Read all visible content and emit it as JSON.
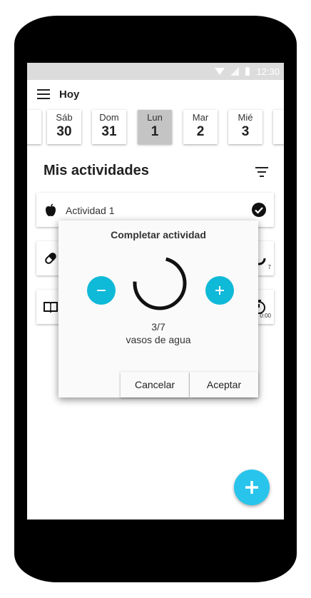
{
  "status_bar": {
    "time": "12:30"
  },
  "app_bar": {
    "title": "Hoy"
  },
  "dates": [
    {
      "day": "Sáb",
      "num": "30"
    },
    {
      "day": "Dom",
      "num": "31"
    },
    {
      "day": "Lun",
      "num": "1",
      "selected": true
    },
    {
      "day": "Mar",
      "num": "2"
    },
    {
      "day": "Mié",
      "num": "3"
    }
  ],
  "section": {
    "title": "Mis actividades"
  },
  "activities": [
    {
      "label": "Actividad 1",
      "icon": "apple-icon",
      "status_icon": "check-circle-icon"
    },
    {
      "label": "",
      "icon": "pill-icon",
      "status_icon": "progress-icon",
      "sub": "7"
    },
    {
      "label": "",
      "icon": "book-icon",
      "status_icon": "timer-icon",
      "sub": "0:00"
    }
  ],
  "dialog": {
    "title": "Completar actividad",
    "progress": "3/7",
    "progress_fraction": 0.43,
    "unit": "vasos de agua",
    "cancel_label": "Cancelar",
    "accept_label": "Aceptar"
  },
  "colors": {
    "accent": "#0fb9d8",
    "fab": "#28c4ec",
    "selected_date": "#c4c4c4",
    "status_bar": "#dcdcdc"
  }
}
